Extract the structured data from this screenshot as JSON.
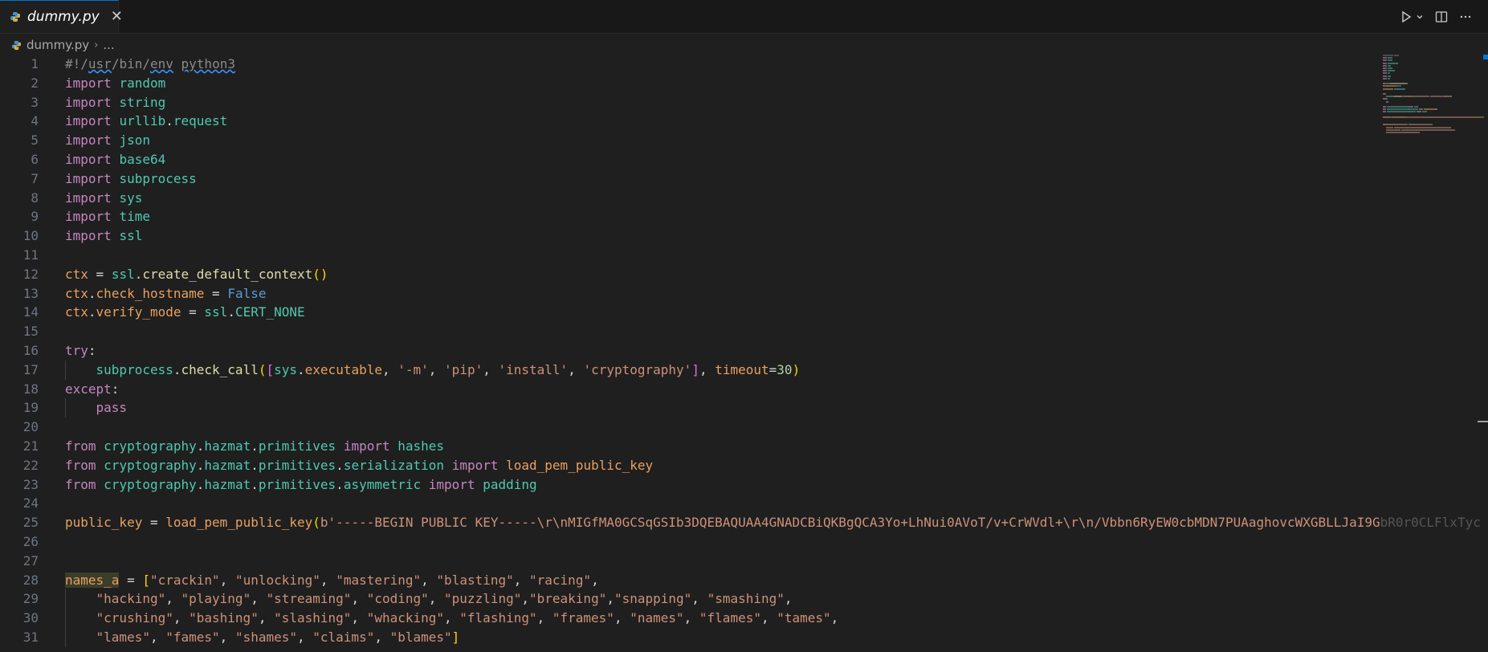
{
  "tab": {
    "filename": "dummy.py",
    "close_glyph": "✕"
  },
  "actions": {
    "run_icon": "run-icon",
    "dropdown_icon": "chevron-down-icon",
    "split_icon": "split-editor-icon",
    "more_icon": "more-icon"
  },
  "breadcrumb": {
    "file": "dummy.py",
    "separator": "›",
    "more": "..."
  },
  "colors": {
    "keyword": "#c586c0",
    "module": "#4ec9b0",
    "variable": "#e9a05f",
    "function": "#dcdcaa",
    "string": "#ce9178",
    "bool": "#569cd6",
    "number": "#b5cea8",
    "text": "#d4d4d4"
  },
  "lines": [
    {
      "n": "1",
      "tokens": [
        {
          "t": "#!/",
          "c": "shebang"
        },
        {
          "t": "usr",
          "c": "shebang err"
        },
        {
          "t": "/bin/",
          "c": "shebang"
        },
        {
          "t": "env",
          "c": "shebang err"
        },
        {
          "t": " ",
          "c": "shebang"
        },
        {
          "t": "python3",
          "c": "shebang err"
        }
      ]
    },
    {
      "n": "2",
      "tokens": [
        {
          "t": "import",
          "c": "kw"
        },
        {
          "t": " ",
          "c": "plain"
        },
        {
          "t": "random",
          "c": "mod"
        }
      ]
    },
    {
      "n": "3",
      "tokens": [
        {
          "t": "import",
          "c": "kw"
        },
        {
          "t": " ",
          "c": "plain"
        },
        {
          "t": "string",
          "c": "mod"
        }
      ]
    },
    {
      "n": "4",
      "tokens": [
        {
          "t": "import",
          "c": "kw"
        },
        {
          "t": " ",
          "c": "plain"
        },
        {
          "t": "urllib",
          "c": "mod"
        },
        {
          "t": ".",
          "c": "plain"
        },
        {
          "t": "request",
          "c": "mod"
        }
      ]
    },
    {
      "n": "5",
      "tokens": [
        {
          "t": "import",
          "c": "kw"
        },
        {
          "t": " ",
          "c": "plain"
        },
        {
          "t": "json",
          "c": "mod"
        }
      ]
    },
    {
      "n": "6",
      "tokens": [
        {
          "t": "import",
          "c": "kw"
        },
        {
          "t": " ",
          "c": "plain"
        },
        {
          "t": "base64",
          "c": "mod"
        }
      ]
    },
    {
      "n": "7",
      "tokens": [
        {
          "t": "import",
          "c": "kw"
        },
        {
          "t": " ",
          "c": "plain"
        },
        {
          "t": "subprocess",
          "c": "mod"
        }
      ]
    },
    {
      "n": "8",
      "tokens": [
        {
          "t": "import",
          "c": "kw"
        },
        {
          "t": " ",
          "c": "plain"
        },
        {
          "t": "sys",
          "c": "mod"
        }
      ]
    },
    {
      "n": "9",
      "tokens": [
        {
          "t": "import",
          "c": "kw"
        },
        {
          "t": " ",
          "c": "plain"
        },
        {
          "t": "time",
          "c": "mod"
        }
      ]
    },
    {
      "n": "10",
      "tokens": [
        {
          "t": "import",
          "c": "kw"
        },
        {
          "t": " ",
          "c": "plain"
        },
        {
          "t": "ssl",
          "c": "mod"
        }
      ]
    },
    {
      "n": "11",
      "tokens": []
    },
    {
      "n": "12",
      "tokens": [
        {
          "t": "ctx",
          "c": "var"
        },
        {
          "t": " = ",
          "c": "plain"
        },
        {
          "t": "ssl",
          "c": "mod"
        },
        {
          "t": ".",
          "c": "plain"
        },
        {
          "t": "create_default_context",
          "c": "fn"
        },
        {
          "t": "()",
          "c": "brk1"
        }
      ]
    },
    {
      "n": "13",
      "tokens": [
        {
          "t": "ctx",
          "c": "var"
        },
        {
          "t": ".",
          "c": "plain"
        },
        {
          "t": "check_hostname",
          "c": "var"
        },
        {
          "t": " = ",
          "c": "plain"
        },
        {
          "t": "False",
          "c": "bool"
        }
      ]
    },
    {
      "n": "14",
      "tokens": [
        {
          "t": "ctx",
          "c": "var"
        },
        {
          "t": ".",
          "c": "plain"
        },
        {
          "t": "verify_mode",
          "c": "var"
        },
        {
          "t": " = ",
          "c": "plain"
        },
        {
          "t": "ssl",
          "c": "mod"
        },
        {
          "t": ".",
          "c": "plain"
        },
        {
          "t": "CERT_NONE",
          "c": "mod"
        }
      ]
    },
    {
      "n": "15",
      "tokens": []
    },
    {
      "n": "16",
      "tokens": [
        {
          "t": "try",
          "c": "kw"
        },
        {
          "t": ":",
          "c": "plain"
        }
      ]
    },
    {
      "n": "17",
      "tokens": [
        {
          "t": "    ",
          "c": "plain"
        },
        {
          "t": "subprocess",
          "c": "mod"
        },
        {
          "t": ".",
          "c": "plain"
        },
        {
          "t": "check_call",
          "c": "fn"
        },
        {
          "t": "(",
          "c": "brk1"
        },
        {
          "t": "[",
          "c": "brk2"
        },
        {
          "t": "sys",
          "c": "mod"
        },
        {
          "t": ".",
          "c": "plain"
        },
        {
          "t": "executable",
          "c": "var"
        },
        {
          "t": ", ",
          "c": "plain"
        },
        {
          "t": "'-m'",
          "c": "str"
        },
        {
          "t": ", ",
          "c": "plain"
        },
        {
          "t": "'pip'",
          "c": "str"
        },
        {
          "t": ", ",
          "c": "plain"
        },
        {
          "t": "'install'",
          "c": "str"
        },
        {
          "t": ", ",
          "c": "plain"
        },
        {
          "t": "'cryptography'",
          "c": "str"
        },
        {
          "t": "]",
          "c": "brk2"
        },
        {
          "t": ", ",
          "c": "plain"
        },
        {
          "t": "timeout",
          "c": "var"
        },
        {
          "t": "=",
          "c": "plain"
        },
        {
          "t": "30",
          "c": "num"
        },
        {
          "t": ")",
          "c": "brk1"
        }
      ]
    },
    {
      "n": "18",
      "tokens": [
        {
          "t": "except",
          "c": "kw"
        },
        {
          "t": ":",
          "c": "plain"
        }
      ]
    },
    {
      "n": "19",
      "tokens": [
        {
          "t": "    ",
          "c": "plain"
        },
        {
          "t": "pass",
          "c": "kw"
        }
      ]
    },
    {
      "n": "20",
      "tokens": []
    },
    {
      "n": "21",
      "tokens": [
        {
          "t": "from",
          "c": "kw"
        },
        {
          "t": " ",
          "c": "plain"
        },
        {
          "t": "cryptography",
          "c": "mod"
        },
        {
          "t": ".",
          "c": "plain"
        },
        {
          "t": "hazmat",
          "c": "mod"
        },
        {
          "t": ".",
          "c": "plain"
        },
        {
          "t": "primitives",
          "c": "mod"
        },
        {
          "t": " ",
          "c": "plain"
        },
        {
          "t": "import",
          "c": "kw"
        },
        {
          "t": " ",
          "c": "plain"
        },
        {
          "t": "hashes",
          "c": "mod"
        }
      ]
    },
    {
      "n": "22",
      "tokens": [
        {
          "t": "from",
          "c": "kw"
        },
        {
          "t": " ",
          "c": "plain"
        },
        {
          "t": "cryptography",
          "c": "mod"
        },
        {
          "t": ".",
          "c": "plain"
        },
        {
          "t": "hazmat",
          "c": "mod"
        },
        {
          "t": ".",
          "c": "plain"
        },
        {
          "t": "primitives",
          "c": "mod"
        },
        {
          "t": ".",
          "c": "plain"
        },
        {
          "t": "serialization",
          "c": "mod"
        },
        {
          "t": " ",
          "c": "plain"
        },
        {
          "t": "import",
          "c": "kw"
        },
        {
          "t": " ",
          "c": "plain"
        },
        {
          "t": "load_pem_public_key",
          "c": "var"
        }
      ]
    },
    {
      "n": "23",
      "tokens": [
        {
          "t": "from",
          "c": "kw"
        },
        {
          "t": " ",
          "c": "plain"
        },
        {
          "t": "cryptography",
          "c": "mod"
        },
        {
          "t": ".",
          "c": "plain"
        },
        {
          "t": "hazmat",
          "c": "mod"
        },
        {
          "t": ".",
          "c": "plain"
        },
        {
          "t": "primitives",
          "c": "mod"
        },
        {
          "t": ".",
          "c": "plain"
        },
        {
          "t": "asymmetric",
          "c": "mod"
        },
        {
          "t": " ",
          "c": "plain"
        },
        {
          "t": "import",
          "c": "kw"
        },
        {
          "t": " ",
          "c": "plain"
        },
        {
          "t": "padding",
          "c": "mod"
        }
      ]
    },
    {
      "n": "24",
      "tokens": []
    },
    {
      "n": "25",
      "tokens": [
        {
          "t": "public_key",
          "c": "var"
        },
        {
          "t": " = ",
          "c": "plain"
        },
        {
          "t": "load_pem_public_key",
          "c": "var"
        },
        {
          "t": "(",
          "c": "brk1"
        },
        {
          "t": "b'-----BEGIN PUBLIC KEY-----\\r\\nMIGfMA0GCSqGSIb3DQEBAQUAA4GNADCBiQKBgQCA3Yo+LhNui0AVoT/v+CrWVdl+\\r\\n/Vbbn6RyEW0cbMDN7PUAaghovcWXGBLLJaI9G",
          "c": "str"
        },
        {
          "t": "bR0r0CLFlxTyc",
          "c": "faded"
        }
      ]
    },
    {
      "n": "26",
      "tokens": []
    },
    {
      "n": "27",
      "tokens": []
    },
    {
      "n": "28",
      "tokens": [
        {
          "t": "names_a",
          "c": "var hl"
        },
        {
          "t": " = ",
          "c": "plain"
        },
        {
          "t": "[",
          "c": "brk1"
        },
        {
          "t": "\"crackin\"",
          "c": "str"
        },
        {
          "t": ", ",
          "c": "plain"
        },
        {
          "t": "\"unlocking\"",
          "c": "str"
        },
        {
          "t": ", ",
          "c": "plain"
        },
        {
          "t": "\"mastering\"",
          "c": "str"
        },
        {
          "t": ", ",
          "c": "plain"
        },
        {
          "t": "\"blasting\"",
          "c": "str"
        },
        {
          "t": ", ",
          "c": "plain"
        },
        {
          "t": "\"racing\"",
          "c": "str"
        },
        {
          "t": ",",
          "c": "plain"
        }
      ]
    },
    {
      "n": "29",
      "tokens": [
        {
          "t": "    ",
          "c": "plain"
        },
        {
          "t": "\"hacking\"",
          "c": "str"
        },
        {
          "t": ", ",
          "c": "plain"
        },
        {
          "t": "\"playing\"",
          "c": "str"
        },
        {
          "t": ", ",
          "c": "plain"
        },
        {
          "t": "\"streaming\"",
          "c": "str"
        },
        {
          "t": ", ",
          "c": "plain"
        },
        {
          "t": "\"coding\"",
          "c": "str"
        },
        {
          "t": ", ",
          "c": "plain"
        },
        {
          "t": "\"puzzling\"",
          "c": "str"
        },
        {
          "t": ",",
          "c": "plain"
        },
        {
          "t": "\"breaking\"",
          "c": "str"
        },
        {
          "t": ",",
          "c": "plain"
        },
        {
          "t": "\"snapping\"",
          "c": "str"
        },
        {
          "t": ", ",
          "c": "plain"
        },
        {
          "t": "\"smashing\"",
          "c": "str"
        },
        {
          "t": ",",
          "c": "plain"
        }
      ]
    },
    {
      "n": "30",
      "tokens": [
        {
          "t": "    ",
          "c": "plain"
        },
        {
          "t": "\"crushing\"",
          "c": "str"
        },
        {
          "t": ", ",
          "c": "plain"
        },
        {
          "t": "\"bashing\"",
          "c": "str"
        },
        {
          "t": ", ",
          "c": "plain"
        },
        {
          "t": "\"slashing\"",
          "c": "str"
        },
        {
          "t": ", ",
          "c": "plain"
        },
        {
          "t": "\"whacking\"",
          "c": "str"
        },
        {
          "t": ", ",
          "c": "plain"
        },
        {
          "t": "\"flashing\"",
          "c": "str"
        },
        {
          "t": ", ",
          "c": "plain"
        },
        {
          "t": "\"frames\"",
          "c": "str"
        },
        {
          "t": ", ",
          "c": "plain"
        },
        {
          "t": "\"names\"",
          "c": "str"
        },
        {
          "t": ", ",
          "c": "plain"
        },
        {
          "t": "\"flames\"",
          "c": "str"
        },
        {
          "t": ", ",
          "c": "plain"
        },
        {
          "t": "\"tames\"",
          "c": "str"
        },
        {
          "t": ",",
          "c": "plain"
        }
      ]
    },
    {
      "n": "31",
      "tokens": [
        {
          "t": "    ",
          "c": "plain"
        },
        {
          "t": "\"lames\"",
          "c": "str"
        },
        {
          "t": ", ",
          "c": "plain"
        },
        {
          "t": "\"fames\"",
          "c": "str"
        },
        {
          "t": ", ",
          "c": "plain"
        },
        {
          "t": "\"shames\"",
          "c": "str"
        },
        {
          "t": ", ",
          "c": "plain"
        },
        {
          "t": "\"claims\"",
          "c": "str"
        },
        {
          "t": ", ",
          "c": "plain"
        },
        {
          "t": "\"blames\"",
          "c": "str"
        },
        {
          "t": "]",
          "c": "brk1"
        }
      ]
    }
  ]
}
